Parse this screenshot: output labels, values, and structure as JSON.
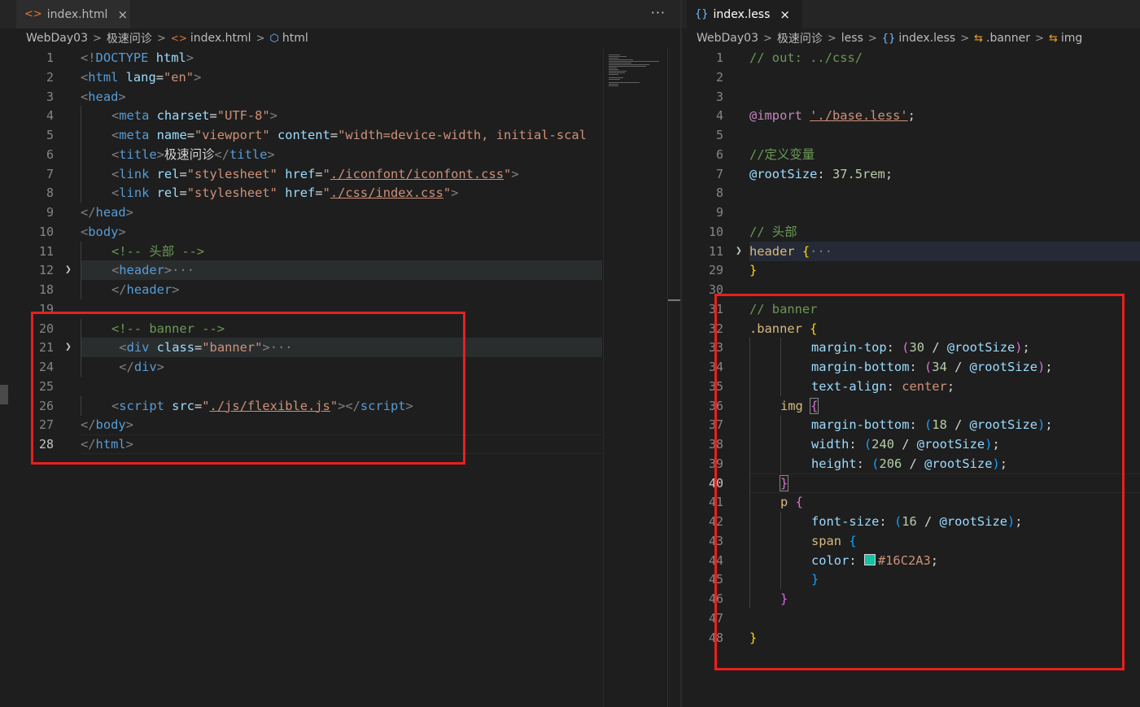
{
  "left": {
    "tab": {
      "icon": "html-file-icon",
      "label": "index.html",
      "close": "×"
    },
    "more": "···",
    "breadcrumb": [
      "WebDay03",
      "极速问诊",
      "index.html",
      "html"
    ],
    "lines": [
      {
        "n": "1",
        "html": "<span class='c-br'>&lt;!</span><span class='c-tag'>DOCTYPE</span> <span class='c-attr'>html</span><span class='c-br'>&gt;</span>",
        "indent": 0
      },
      {
        "n": "2",
        "html": "<span class='c-br'>&lt;</span><span class='c-tag'>html</span> <span class='c-attr'>lang</span>=<span class='c-str'>\"en\"</span><span class='c-br'>&gt;</span>",
        "indent": 0
      },
      {
        "n": "3",
        "html": "<span class='c-br'>&lt;</span><span class='c-tag'>head</span><span class='c-br'>&gt;</span>",
        "indent": 0
      },
      {
        "n": "4",
        "html": "<span class='c-br'>&lt;</span><span class='c-tag'>meta</span> <span class='c-attr'>charset</span>=<span class='c-str'>\"UTF-8\"</span><span class='c-br'>&gt;</span>",
        "indent": 1
      },
      {
        "n": "5",
        "html": "<span class='c-br'>&lt;</span><span class='c-tag'>meta</span> <span class='c-attr'>name</span>=<span class='c-str'>\"viewport\"</span> <span class='c-attr'>content</span>=<span class='c-str'>\"width=device-width, initial-scal</span>",
        "indent": 1
      },
      {
        "n": "6",
        "html": "<span class='c-br'>&lt;</span><span class='c-tag'>title</span><span class='c-br'>&gt;</span><span class='c-txt'>极速问诊</span><span class='c-br'>&lt;/</span><span class='c-tag'>title</span><span class='c-br'>&gt;</span>",
        "indent": 1
      },
      {
        "n": "7",
        "html": "<span class='c-br'>&lt;</span><span class='c-tag'>link</span> <span class='c-attr'>rel</span>=<span class='c-str'>\"stylesheet\"</span> <span class='c-attr'>href</span>=<span class='c-str'>\"<span class='u'>./iconfont/iconfont.css</span>\"</span><span class='c-br'>&gt;</span>",
        "indent": 1
      },
      {
        "n": "8",
        "html": "<span class='c-br'>&lt;</span><span class='c-tag'>link</span> <span class='c-attr'>rel</span>=<span class='c-str'>\"stylesheet\"</span> <span class='c-attr'>href</span>=<span class='c-str'>\"<span class='u'>./css/index.css</span>\"</span><span class='c-br'>&gt;</span>",
        "indent": 1
      },
      {
        "n": "9",
        "html": "<span class='c-br'>&lt;/</span><span class='c-tag'>head</span><span class='c-br'>&gt;</span>",
        "indent": 0
      },
      {
        "n": "10",
        "html": "<span class='c-br'>&lt;</span><span class='c-tag'>body</span><span class='c-br'>&gt;</span>",
        "indent": 0
      },
      {
        "n": "11",
        "html": "<span class='c-com'>&lt;!-- 头部 --&gt;</span>",
        "indent": 1
      },
      {
        "n": "12",
        "html": "<span class='c-br'>&lt;</span><span class='c-tag'>header</span><span class='c-br'>&gt;</span><span class='c-br'>···</span>",
        "indent": 1,
        "fold": true,
        "hl": true
      },
      {
        "n": "18",
        "html": "<span class='c-br'>&lt;/</span><span class='c-tag'>header</span><span class='c-br'>&gt;</span>",
        "indent": 1
      },
      {
        "n": "19",
        "html": "",
        "indent": 0
      },
      {
        "n": "20",
        "html": "<span class='c-com'>&lt;!-- banner --&gt;</span>",
        "indent": 1
      },
      {
        "n": "21",
        "html": " <span class='c-br'>&lt;</span><span class='c-tag'>div</span> <span class='c-attr'>class</span>=<span class='c-str'>\"banner\"</span><span class='c-br'>&gt;</span><span class='c-br'>···</span>",
        "indent": 1,
        "fold": true,
        "hl": true
      },
      {
        "n": "24",
        "html": " <span class='c-br'>&lt;/</span><span class='c-tag'>div</span><span class='c-br'>&gt;</span>",
        "indent": 1
      },
      {
        "n": "25",
        "html": "",
        "indent": 0
      },
      {
        "n": "26",
        "html": "<span class='c-br'>&lt;</span><span class='c-tag'>script</span> <span class='c-attr'>src</span>=<span class='c-str'>\"<span class='u'>./js/flexible.js</span>\"</span><span class='c-br'>&gt;&lt;/</span><span class='c-tag'>script</span><span class='c-br'>&gt;</span>",
        "indent": 1
      },
      {
        "n": "27",
        "html": "<span class='c-br'>&lt;/</span><span class='c-tag'>body</span><span class='c-br'>&gt;</span>",
        "indent": 0
      },
      {
        "n": "28",
        "html": "<span class='c-br'>&lt;/</span><span class='c-tag'>html</span><span class='c-br'>&gt;</span>",
        "indent": 0,
        "current": true
      }
    ]
  },
  "right": {
    "tab": {
      "icon": "braces-icon",
      "label": "index.less",
      "close": "×"
    },
    "breadcrumb": [
      "WebDay03",
      "极速问诊",
      "less",
      "index.less",
      ".banner",
      "img"
    ],
    "lines": [
      {
        "n": "1",
        "html": "<span class='c-com'>// out: ../css/</span>",
        "indent": 0
      },
      {
        "n": "2",
        "html": "",
        "indent": 0
      },
      {
        "n": "3",
        "html": "",
        "indent": 0
      },
      {
        "n": "4",
        "html": "<span class='c-kw'>@import</span> <span class='c-str u'>'./base.less'</span>;",
        "indent": 0
      },
      {
        "n": "5",
        "html": "",
        "indent": 0
      },
      {
        "n": "6",
        "html": "<span class='c-com'>//定义变量</span>",
        "indent": 0
      },
      {
        "n": "7",
        "html": "<span class='c-attr'>@rootSize</span>: <span class='c-num'>37.5rem</span>;",
        "indent": 0
      },
      {
        "n": "8",
        "html": "",
        "indent": 0
      },
      {
        "n": "9",
        "html": "",
        "indent": 0
      },
      {
        "n": "10",
        "html": "<span class='c-com'>// 头部</span>",
        "indent": 0
      },
      {
        "n": "11",
        "html": "<span class='c-sel'>header</span> <span class='c-y'>{</span><span class='c-br'>···</span>",
        "indent": 0,
        "fold": true,
        "hl": true
      },
      {
        "n": "29",
        "html": "<span class='c-y'>}</span>",
        "indent": 0
      },
      {
        "n": "30",
        "html": "",
        "indent": 0
      },
      {
        "n": "31",
        "html": "<span class='c-com'>// banner</span>",
        "indent": 0
      },
      {
        "n": "32",
        "html": "<span class='c-sel'>.banner</span> <span class='c-y'>{</span>",
        "indent": 0
      },
      {
        "n": "33",
        "html": "<span class='c-prop'>margin-top</span>: <span class='c-p'>(</span><span class='c-num'>30</span> / <span class='c-attr'>@rootSize</span><span class='c-p'>)</span>;",
        "indent": 2
      },
      {
        "n": "34",
        "html": "<span class='c-prop'>margin-bottom</span>: <span class='c-p'>(</span><span class='c-num'>34</span> / <span class='c-attr'>@rootSize</span><span class='c-p'>)</span>;",
        "indent": 2
      },
      {
        "n": "35",
        "html": "<span class='c-prop'>text-align</span>: <span class='c-val'>center</span>;",
        "indent": 2
      },
      {
        "n": "36",
        "html": "<span class='c-sel'>img</span> <span class='c-p' style='outline:1px solid #888'>{</span>",
        "indent": 1
      },
      {
        "n": "37",
        "html": "<span class='c-prop'>margin-bottom</span>: <span class='c-b'>(</span><span class='c-num'>18</span> / <span class='c-attr'>@rootSize</span><span class='c-b'>)</span>;",
        "indent": 2
      },
      {
        "n": "38",
        "html": "<span class='c-prop'>width</span>: <span class='c-b'>(</span><span class='c-num'>240</span> / <span class='c-attr'>@rootSize</span><span class='c-b'>)</span>;",
        "indent": 2
      },
      {
        "n": "39",
        "html": "<span class='c-prop'>height</span>: <span class='c-b'>(</span><span class='c-num'>206</span> / <span class='c-attr'>@rootSize</span><span class='c-b'>)</span>;",
        "indent": 2
      },
      {
        "n": "40",
        "html": "<span class='c-p' style='outline:1px solid #888'>}</span>",
        "indent": 1,
        "current": true
      },
      {
        "n": "41",
        "html": "<span class='c-sel'>p</span> <span class='c-p'>{</span>",
        "indent": 1
      },
      {
        "n": "42",
        "html": "<span class='c-prop'>font-size</span>: <span class='c-b'>(</span><span class='c-num'>16</span> / <span class='c-attr'>@rootSize</span><span class='c-b'>)</span>;",
        "indent": 2
      },
      {
        "n": "43",
        "html": "<span class='c-sel'>span</span> <span class='c-b'>{</span>",
        "indent": 2
      },
      {
        "n": "44",
        "html": "<span class='c-prop'>color</span>: <span class='swatch' style='background:#16C2A3'></span><span class='c-val'>#16C2A3</span>;",
        "indent": 2
      },
      {
        "n": "45",
        "html": "<span class='c-b'>}</span>",
        "indent": 2
      },
      {
        "n": "46",
        "html": "<span class='c-p'>}</span>",
        "indent": 1
      },
      {
        "n": "47",
        "html": "",
        "indent": 0
      },
      {
        "n": "48",
        "html": "<span class='c-y'>}</span>",
        "indent": 0
      }
    ]
  },
  "colors": {
    "accent_red": "#e8201e",
    "swatch": "#16C2A3"
  }
}
